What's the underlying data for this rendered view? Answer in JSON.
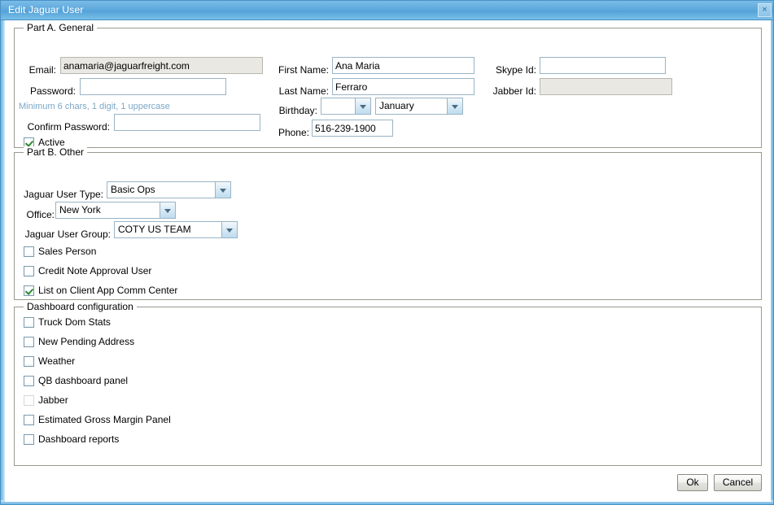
{
  "window": {
    "title": "Edit Jaguar User",
    "close_label": "×",
    "accent_color": "#5fa9dc",
    "frame_border_color": "#4a90c4",
    "background_color": "#ffffff"
  },
  "part_a": {
    "legend": "Part A. General",
    "email": {
      "label": "Email:",
      "value": "anamaria@jaguarfreight.com",
      "placeholder": "",
      "disabled": true
    },
    "password": {
      "label": "Password:",
      "value": "",
      "placeholder": ""
    },
    "password_hint": "Minimum 6 chars, 1 digit, 1 uppercase",
    "password_hint_color": "#7ba7c7",
    "confirm_password": {
      "label": "Confirm Password:",
      "value": "",
      "placeholder": ""
    },
    "active": {
      "label": "Active",
      "checked": true
    },
    "first_name": {
      "label": "First Name:",
      "value": "Ana Maria",
      "placeholder": ""
    },
    "last_name": {
      "label": "Last Name:",
      "value": "Ferraro",
      "placeholder": ""
    },
    "birthday": {
      "label": "Birthday:",
      "day_value": "",
      "month_value": "January"
    },
    "phone": {
      "label": "Phone:",
      "value": "516-239-1900",
      "placeholder": ""
    },
    "skype_id": {
      "label": "Skype Id:",
      "value": "",
      "placeholder": ""
    },
    "jabber_id": {
      "label": "Jabber Id:",
      "value": "",
      "placeholder": "",
      "disabled": true
    }
  },
  "part_b": {
    "legend": "Part B. Other",
    "user_type": {
      "label": "Jaguar User Type:",
      "value": "Basic Ops"
    },
    "office": {
      "label": "Office:",
      "value": "New York"
    },
    "user_group": {
      "label": "Jaguar User Group:",
      "value": "COTY US TEAM"
    },
    "checkboxes": [
      {
        "label": "Sales Person",
        "checked": false,
        "disabled": false
      },
      {
        "label": "Credit Note Approval User",
        "checked": false,
        "disabled": false
      },
      {
        "label": "List on Client App Comm Center",
        "checked": true,
        "disabled": false
      }
    ]
  },
  "dashboard": {
    "legend": "Dashboard configuration",
    "checkboxes": [
      {
        "label": "Truck Dom Stats",
        "checked": false,
        "disabled": false
      },
      {
        "label": "New Pending Address",
        "checked": false,
        "disabled": false
      },
      {
        "label": "Weather",
        "checked": false,
        "disabled": false
      },
      {
        "label": "QB dashboard panel",
        "checked": false,
        "disabled": false
      },
      {
        "label": "Jabber",
        "checked": false,
        "disabled": true
      },
      {
        "label": "Estimated Gross Margin Panel",
        "checked": false,
        "disabled": false
      },
      {
        "label": "Dashboard reports",
        "checked": false,
        "disabled": false
      }
    ]
  },
  "footer": {
    "ok_label": "Ok",
    "cancel_label": "Cancel"
  }
}
